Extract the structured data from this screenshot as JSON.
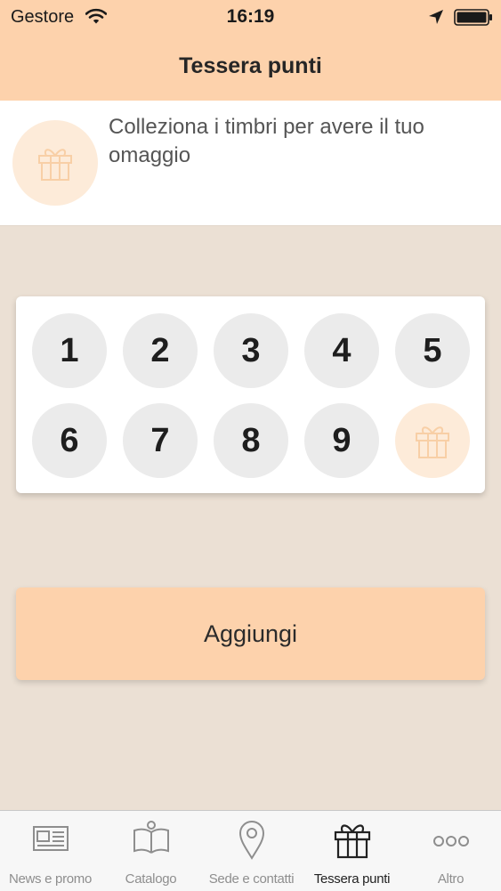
{
  "status_bar": {
    "carrier": "Gestore",
    "time": "16:19"
  },
  "nav": {
    "title": "Tessera punti"
  },
  "banner": {
    "text": "Colleziona i timbri per avere il tuo omaggio",
    "icon": "gift-icon"
  },
  "stamp_card": {
    "stamps": [
      "1",
      "2",
      "3",
      "4",
      "5",
      "6",
      "7",
      "8",
      "9"
    ],
    "reward_icon": "gift-icon",
    "collected": 0
  },
  "add_button": {
    "label": "Aggiungi"
  },
  "tab_bar": {
    "tabs": [
      {
        "label": "News e promo",
        "icon": "newspaper-icon",
        "active": false
      },
      {
        "label": "Catalogo",
        "icon": "open-book-icon",
        "active": false
      },
      {
        "label": "Sede e contatti",
        "icon": "map-pin-icon",
        "active": false
      },
      {
        "label": "Tessera punti",
        "icon": "gift-icon",
        "active": true
      },
      {
        "label": "Altro",
        "icon": "more-icon",
        "active": false
      }
    ]
  },
  "colors": {
    "header_bg": "#fdd2ac",
    "page_bg": "#ebe0d4",
    "stamp_bg": "#ebebeb",
    "gift_circle_bg": "#fdebd9",
    "gift_stroke": "#f8cfa6"
  }
}
